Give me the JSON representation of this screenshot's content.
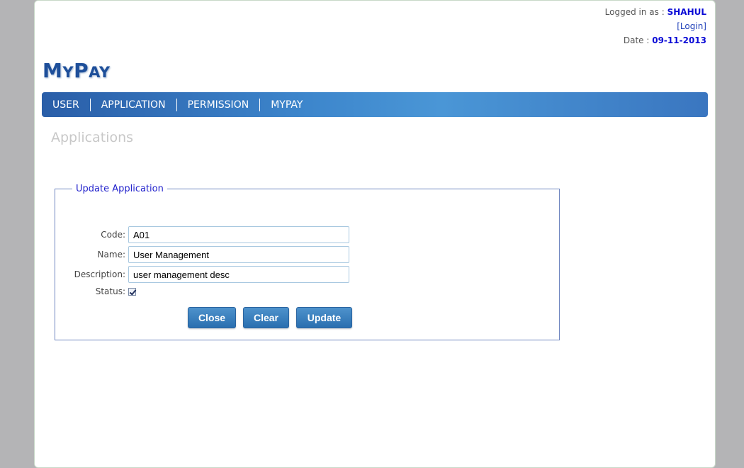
{
  "header": {
    "logged_in_label": "Logged in as :",
    "username": "SHAHUL",
    "login_link": "[Login]",
    "date_label": "Date :",
    "date_value": "09-11-2013"
  },
  "logo": {
    "first_big": "M",
    "first_small": "Y",
    "second_big": "P",
    "second_small": "AY"
  },
  "nav": {
    "items": [
      "USER",
      "APPLICATION",
      "PERMISSION",
      "MYPAY"
    ]
  },
  "page_title": "Applications",
  "form": {
    "legend": "Update Application",
    "code_label": "Code:",
    "code_value": "A01",
    "name_label": "Name:",
    "name_value": "User Management",
    "description_label": "Description:",
    "description_value": "user management desc",
    "status_label": "Status:",
    "status_checked": true,
    "buttons": {
      "close": "Close",
      "clear": "Clear",
      "update": "Update"
    }
  },
  "colors": {
    "nav_blue": "#3d86cc",
    "legend_blue": "#2222cc",
    "button_blue": "#2a6fb0"
  }
}
